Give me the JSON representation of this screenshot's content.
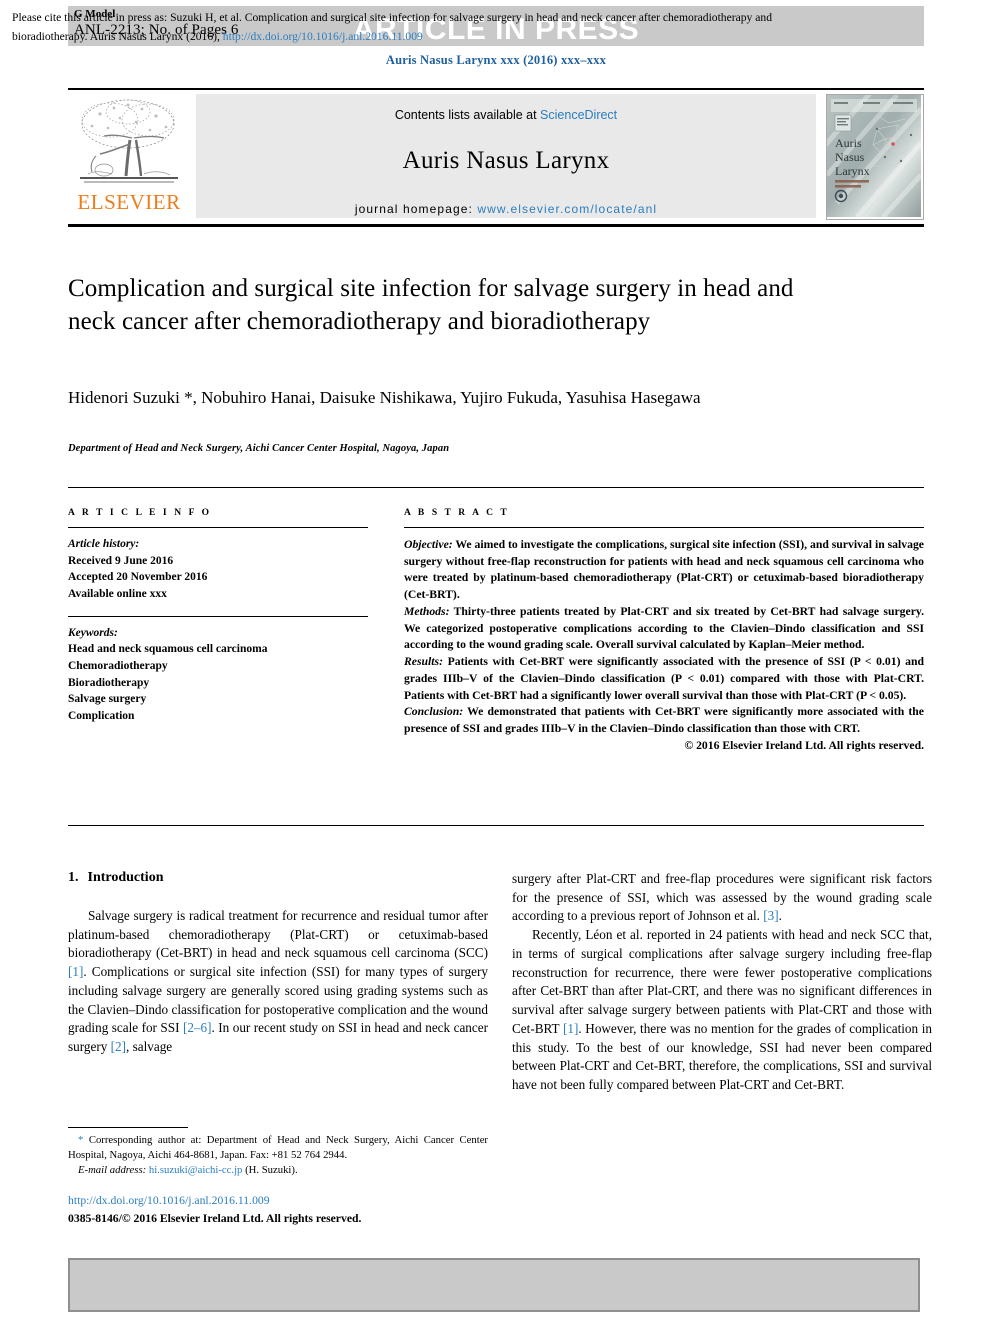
{
  "header": {
    "g_model": "G Model",
    "article_id": "ANL-2213; No. of Pages 6",
    "banner": "ARTICLE IN PRESS",
    "journal_ref": "Auris Nasus Larynx xxx (2016) xxx–xxx"
  },
  "masthead": {
    "contents_prefix": "Contents lists available at ",
    "sciencedirect": "ScienceDirect",
    "journal_title": "Auris Nasus Larynx",
    "homepage_prefix": "journal homepage: ",
    "homepage_url": "www.elsevier.com/locate/anl",
    "publisher": "ELSEVIER",
    "cover_lines": [
      "Auris",
      "Nasus",
      "Larynx"
    ]
  },
  "article": {
    "title": "Complication and surgical site infection for salvage surgery in head and neck cancer after chemoradiotherapy and bioradiotherapy",
    "authors": "Hidenori Suzuki *, Nobuhiro Hanai, Daisuke Nishikawa, Yujiro Fukuda, Yasuhisa Hasegawa",
    "affiliation": "Department of Head and Neck Surgery, Aichi Cancer Center Hospital, Nagoya, Japan"
  },
  "article_info": {
    "heading": "A R T I C L E  I N F O",
    "history_label": "Article history:",
    "received": "Received 9 June 2016",
    "accepted": "Accepted 20 November 2016",
    "available": "Available online xxx",
    "keywords_label": "Keywords:",
    "keywords": [
      "Head and neck squamous cell carcinoma",
      "Chemoradiotherapy",
      "Bioradiotherapy",
      "Salvage surgery",
      "Complication"
    ]
  },
  "abstract": {
    "heading": "A B S T R A C T",
    "objective_label": "Objective:",
    "objective_text": " We aimed to investigate the complications, surgical site infection (SSI), and survival in salvage surgery without free-flap reconstruction for patients with head and neck squamous cell carcinoma who were treated by platinum-based chemoradiotherapy (Plat-CRT) or cetuximab-based bioradiotherapy (Cet-BRT).",
    "methods_label": "Methods:",
    "methods_text": " Thirty-three patients treated by Plat-CRT and six treated by Cet-BRT had salvage surgery. We categorized postoperative complications according to the Clavien–Dindo classification and SSI according to the wound grading scale. Overall survival calculated by Kaplan–Meier method.",
    "results_label": "Results:",
    "results_text": " Patients with Cet-BRT were significantly associated with the presence of SSI (P < 0.01) and grades IIIb–V of the Clavien–Dindo classification (P < 0.01) compared with those with Plat-CRT. Patients with Cet-BRT had a significantly lower overall survival than those with Plat-CRT (P < 0.05).",
    "conclusion_label": "Conclusion:",
    "conclusion_text": " We demonstrated that patients with Cet-BRT were significantly more associated with the presence of SSI and grades IIIb–V in the Clavien–Dindo classification than those with CRT.",
    "copyright": "© 2016 Elsevier Ireland Ltd. All rights reserved."
  },
  "introduction": {
    "number": "1.",
    "heading": "Introduction",
    "para_left_1_a": "Salvage surgery is radical treatment for recurrence and residual tumor after platinum-based chemoradiotherapy (Plat-CRT) or cetuximab-based bioradiotherapy (Cet-BRT) in head and neck squamous cell carcinoma (SCC) ",
    "ref_1a": "[1]",
    "para_left_1_b": ". Complications or surgical site infection (SSI) for many types of surgery including salvage surgery are generally scored using grading systems such as the Clavien–Dindo classification for postoperative complication and the wound grading scale for SSI ",
    "ref_2_6": "[2–6]",
    "para_left_1_c": ". In our recent study on SSI in head and neck cancer surgery ",
    "ref_2": "[2]",
    "para_left_1_d": ", salvage",
    "para_right_1_a": "surgery after Plat-CRT and free-flap procedures were significant risk factors for the presence of SSI, which was assessed by the wound grading scale according to a previous report of Johnson et al. ",
    "ref_3": "[3]",
    "para_right_1_b": ".",
    "para_right_2_a": "Recently, Léon et al. reported in 24 patients with head and neck SCC that, in terms of surgical complications after salvage surgery including free-flap reconstruction for recurrence, there were fewer postoperative complications after Cet-BRT than after Plat-CRT, and there was no significant differences in survival after salvage surgery between patients with Plat-CRT and those with Cet-BRT ",
    "ref_1b": "[1]",
    "para_right_2_b": ". However, there was no mention for the grades of complication in this study. To the best of our knowledge, SSI had never been compared between Plat-CRT and Cet-BRT, therefore, the complications, SSI and survival have not been fully compared between Plat-CRT and Cet-BRT."
  },
  "footnote": {
    "star": "*",
    "corresponding": " Corresponding author at: Department of Head and Neck Surgery, Aichi Cancer Center Hospital, Nagoya, Aichi 464-8681, Japan. Fax: +81 52 764 2944.",
    "email_label": "E-mail address:",
    "email": "hi.suzuki@aichi-cc.jp",
    "email_suffix": " (H. Suzuki).",
    "doi": "http://dx.doi.org/10.1016/j.anl.2016.11.009",
    "issn_line": "0385-8146/© 2016 Elsevier Ireland Ltd. All rights reserved."
  },
  "cite_box": {
    "text": "Please cite this article in press as: Suzuki H, et al. Complication and surgical site infection for salvage surgery in head and neck cancer after chemoradiotherapy and bioradiotherapy. Auris Nasus Larynx (2016), ",
    "link": "http://dx.doi.org/10.1016/j.anl.2016.11.009"
  },
  "colors": {
    "link": "#2b7dbf",
    "banner_bg": "#c9c9c9",
    "elsevier_orange": "#ef7c1a",
    "masthead_bg": "#e9e9e9"
  }
}
